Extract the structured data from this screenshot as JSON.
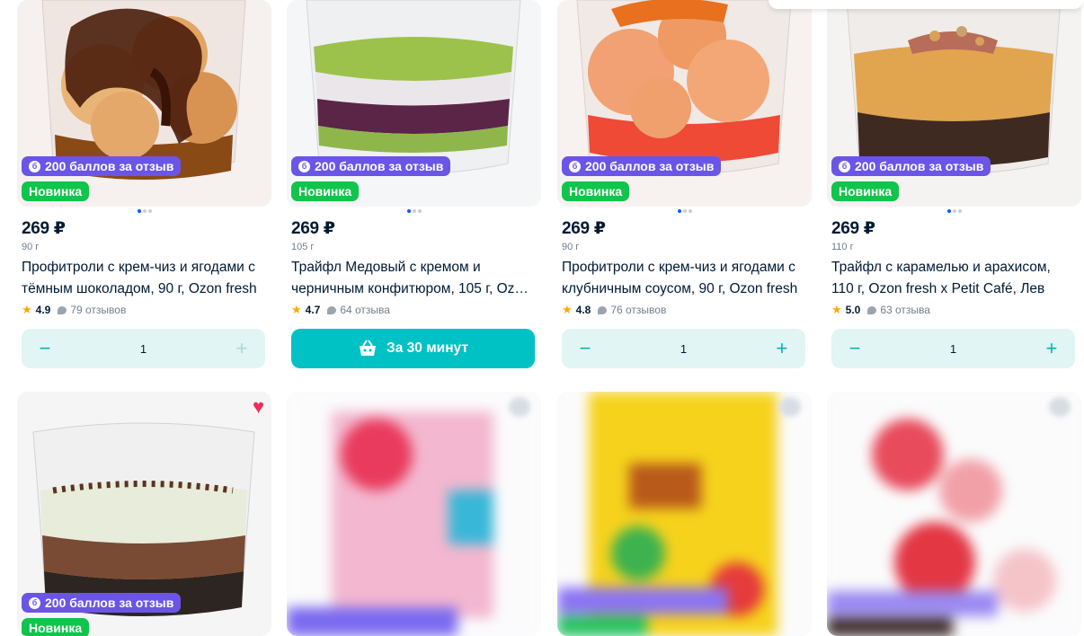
{
  "products_row1": [
    {
      "price": "269 ₽",
      "weight": "90 г",
      "title_l1": "Профитроли с крем-чиз и ягодами с",
      "title_l2": "тёмным шоколадом, 90 г, Ozon fresh",
      "rating": "4.9",
      "reviews": "79 отзывов",
      "points_badge": "200 баллов за отзыв",
      "new_badge": "Новинка",
      "qty": "1",
      "action": "stepper",
      "photo": "profiterole-chocolate"
    },
    {
      "price": "269 ₽",
      "weight": "105 г",
      "title_l1": "Трайфл Медовый с кремом и",
      "title_l2": "черничным конфитюром, 105 г, Ozon fresh",
      "rating": "4.7",
      "reviews": "64 отзыва",
      "points_badge": "200 баллов за отзыв",
      "new_badge": "Новинка",
      "buy_label": "За 30 минут",
      "action": "buy",
      "photo": "trifle-honey-blueberry"
    },
    {
      "price": "269 ₽",
      "weight": "90 г",
      "title_l1": "Профитроли с крем-чиз и ягодами с",
      "title_l2": "клубничным соусом, 90 г, Ozon fresh",
      "rating": "4.8",
      "reviews": "76 отзывов",
      "points_badge": "200 баллов за отзыв",
      "new_badge": "Новинка",
      "qty": "1",
      "action": "stepper",
      "photo": "profiterole-strawberry"
    },
    {
      "price": "269 ₽",
      "weight": "110 г",
      "title_l1": "Трайфл с карамелью и арахисом,",
      "title_l2": "110 г, Ozon fresh x Petit Café, Лев",
      "rating": "5.0",
      "reviews": "63 отзыва",
      "points_badge": "200 баллов за отзыв",
      "new_badge": "Новинка",
      "qty": "1",
      "action": "stepper",
      "photo": "trifle-caramel-peanut"
    }
  ],
  "products_row2": [
    {
      "points_badge": "200 баллов за отзыв",
      "new_badge": "Новинка",
      "favorite": true,
      "photo": "trifle-chocolate"
    },
    {
      "photo": "blurred-pink-package"
    },
    {
      "photo": "blurred-yellow-package"
    },
    {
      "photo": "blurred-strawberry-product"
    }
  ],
  "icons": {
    "points": "б",
    "star": "★",
    "heart": "♥",
    "minus": "−",
    "plus": "+"
  },
  "colors": {
    "points_badge": "#6b55e6",
    "new_badge": "#10c44c",
    "buy_button": "#00c1c4",
    "stepper_bg": "#e0f5f4",
    "stepper_icon": "#00b3b3",
    "favorite_heart": "#ef2d56",
    "dot_active": "#005bff"
  }
}
